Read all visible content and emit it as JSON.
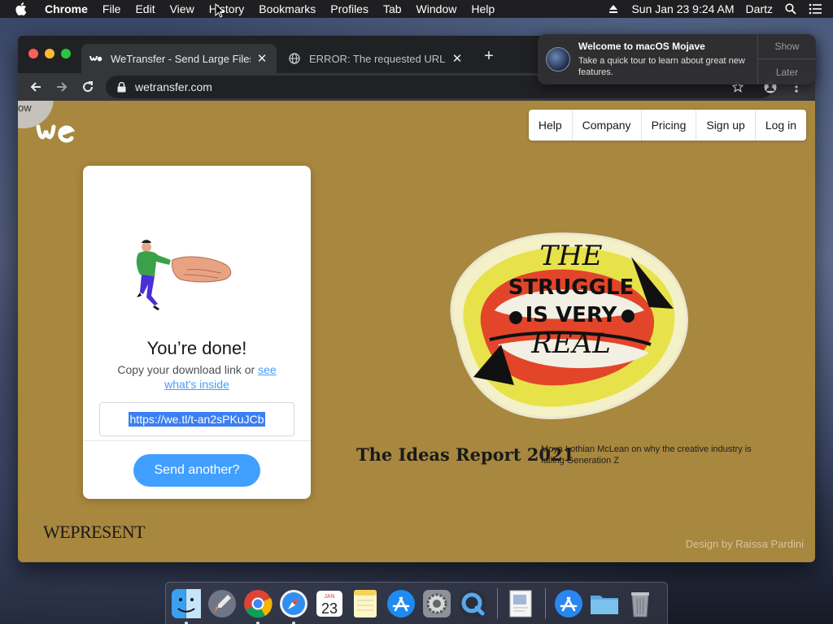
{
  "menubar": {
    "app": "Chrome",
    "items": [
      "File",
      "Edit",
      "View",
      "History",
      "Bookmarks",
      "Profiles",
      "Tab",
      "Window",
      "Help"
    ],
    "datetime": "Sun Jan 23  9:24 AM",
    "user": "Dartz"
  },
  "browser": {
    "tabs": [
      {
        "title": "WeTransfer - Send Large Files"
      },
      {
        "title": "ERROR: The requested URL co"
      }
    ],
    "url": "wetransfer.com"
  },
  "page": {
    "corner_text": "ow",
    "nav": [
      "Help",
      "Company",
      "Pricing",
      "Sign up",
      "Log in"
    ],
    "card": {
      "heading": "You’re done!",
      "subtitle_prefix": "Copy your download link or ",
      "subtitle_link": "see what's inside",
      "download_link": "https://we.tl/t-an2sPKuJCb",
      "button": "Send another?"
    },
    "artwork_lines": [
      "THE",
      "STRUGGLE",
      "IS VERY",
      "REAL"
    ],
    "report_title": "The Ideas Report 2021",
    "report_desc": "Moya Lothian McLean on why the creative industry is failing Generation Z",
    "brand": "WEPRESENT",
    "design_credit": "Design by Raissa Pardini"
  },
  "notification": {
    "title": "Welcome to macOS Mojave",
    "body": "Take a quick tour to learn about great new features.",
    "actions": [
      "Show",
      "Later"
    ]
  },
  "dock": {
    "date_month": "JAN",
    "date_day": "23",
    "apps": [
      "finder-icon",
      "launchpad-icon",
      "chrome-icon",
      "safari-icon",
      "calendar-icon",
      "notes-icon",
      "app-store-icon",
      "system-preferences-icon",
      "quicktime-icon",
      "preview-icon",
      "app-store-downloads-icon",
      "folder-icon",
      "trash-icon"
    ]
  },
  "colors": {
    "page_bg": "#a8873e",
    "accent_blue": "#409fff"
  }
}
